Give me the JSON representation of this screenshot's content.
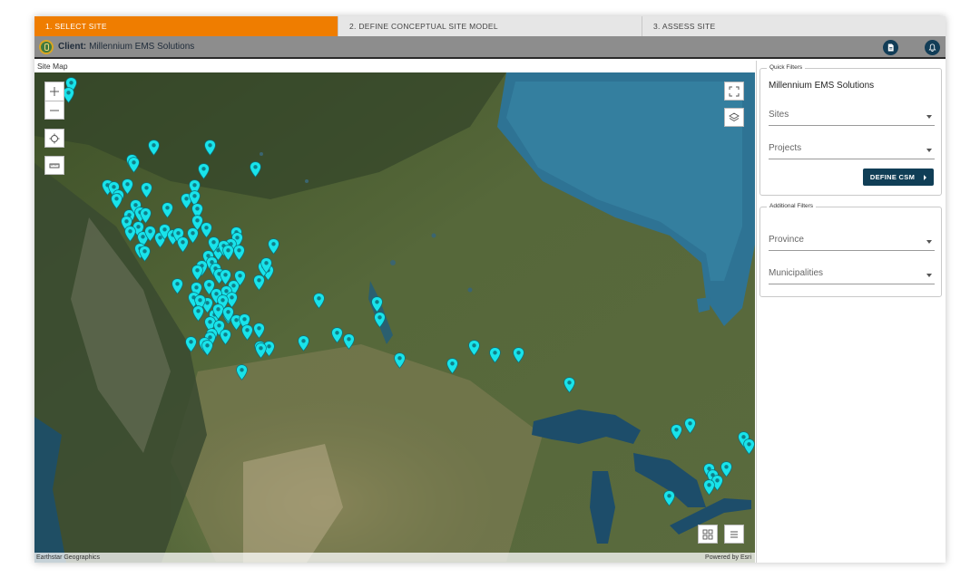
{
  "stepper": {
    "steps": [
      {
        "label": "1. SELECT SITE",
        "active": true
      },
      {
        "label": "2. DEFINE CONCEPTUAL SITE MODEL",
        "active": false
      },
      {
        "label": "3. ASSESS SITE",
        "active": false
      }
    ],
    "active_color": "#ef7d00"
  },
  "header": {
    "client_label": "Client:",
    "client_name": "Millennium EMS Solutions",
    "actions": [
      {
        "icon": "report-icon"
      },
      {
        "icon": "bell-icon"
      }
    ]
  },
  "map": {
    "title": "Site Map",
    "attribution_left": "Earthstar Geographics",
    "attribution_right": "Powered by Esri",
    "marker_color": "#19e3ea",
    "controls": {
      "left": [
        "zoom-in-icon",
        "zoom-out-icon",
        "locate-icon",
        "measure-icon"
      ],
      "right_top": [
        "fullscreen-icon",
        "layers-icon"
      ],
      "bottom_right": [
        "grid-icon",
        "list-icon"
      ]
    }
  },
  "quick_filters": {
    "legend": "Quick Filters",
    "client": "Millennium EMS Solutions",
    "sites_placeholder": "Sites",
    "projects_placeholder": "Projects",
    "button_label": "DEFINE CSM"
  },
  "additional_filters": {
    "legend": "Additional Filters",
    "province_placeholder": "Province",
    "municipalities_placeholder": "Municipalities"
  },
  "colors": {
    "header_dark": "#123d57",
    "button": "#103e56"
  }
}
